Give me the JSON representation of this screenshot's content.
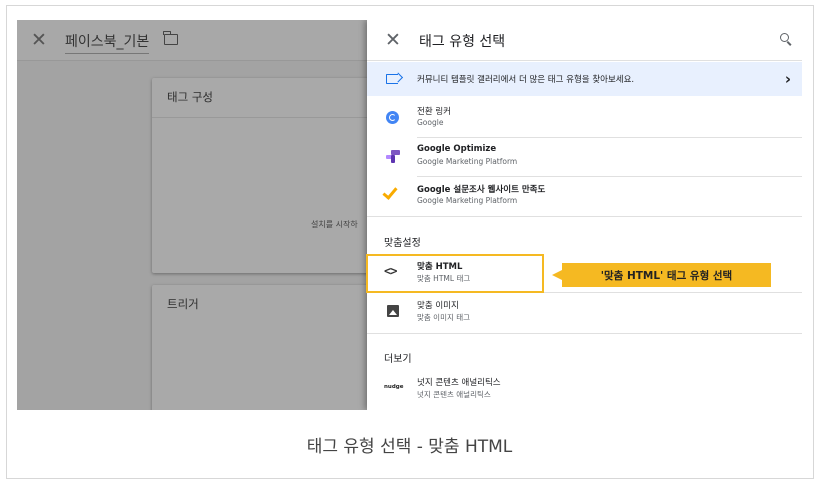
{
  "workspace": {
    "name": "페이스북_기본",
    "tag_card_title": "태그 구성",
    "tag_card_hint": "설치를 시작하",
    "trigger_card_title": "트리거"
  },
  "panel": {
    "title": "태그 유형 선택",
    "banner_text": "커뮤니티 템플릿 갤러리에서 더 많은 태그 유형을 찾아보세요.",
    "featured": [
      {
        "name": "전환 링커",
        "vendor": "Google",
        "icon": "conversion-linker-icon"
      },
      {
        "name": "Google Optimize",
        "vendor": "Google Marketing Platform",
        "icon": "optimize-icon"
      },
      {
        "name": "Google 설문조사 웹사이트 만족도",
        "vendor": "Google Marketing Platform",
        "icon": "checkmark-icon"
      }
    ],
    "custom_section": "맞춤설정",
    "custom": [
      {
        "name": "맞춤 HTML",
        "desc": "맞춤 HTML 태그",
        "icon": "code-icon"
      },
      {
        "name": "맞춤 이미지",
        "desc": "맞춤 이미지 태그",
        "icon": "image-icon"
      }
    ],
    "more_section": "더보기",
    "more": [
      {
        "name": "넛지 콘텐츠 애널리틱스",
        "desc": "넛지 콘텐츠 애널리틱스",
        "icon_text": "nudge"
      }
    ]
  },
  "callout": "'맞춤 HTML' 태그 유형 선택",
  "caption": "태그 유형 선택 - 맞춤 HTML",
  "colors": {
    "accent": "#1a73e8",
    "highlight": "#f5b922",
    "banner_bg": "#e8f0fe"
  }
}
